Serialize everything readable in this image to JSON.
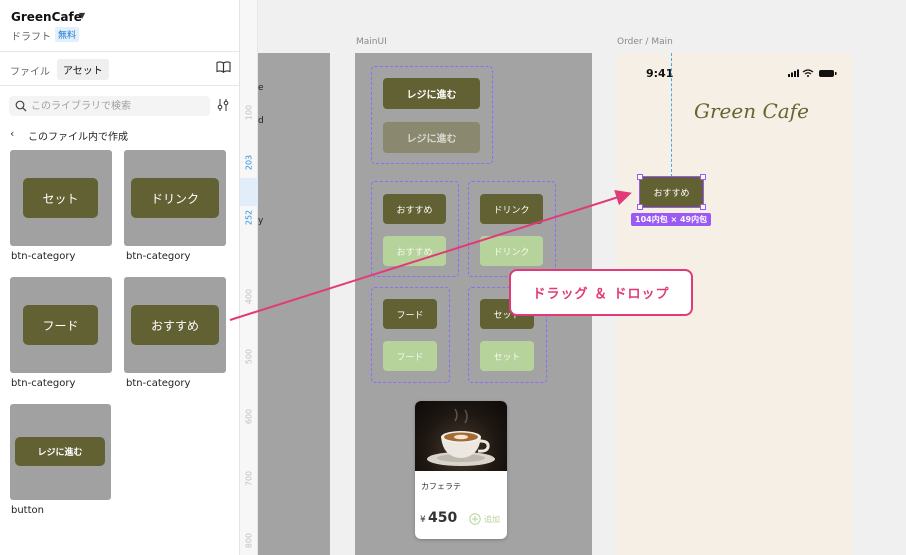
{
  "project": {
    "name": "GreenCafe",
    "status": "ドラフト",
    "plan_badge": "無料"
  },
  "tabs": {
    "file": "ファイル",
    "assets": "アセット"
  },
  "search": {
    "placeholder": "このライブラリで検索"
  },
  "section": {
    "title": "このファイル内で作成"
  },
  "assets": [
    {
      "button_text": "セット",
      "label": "btn-category"
    },
    {
      "button_text": "ドリンク",
      "label": "btn-category"
    },
    {
      "button_text": "フード",
      "label": "btn-category"
    },
    {
      "button_text": "おすすめ",
      "label": "btn-category"
    },
    {
      "button_text": "レジに進む",
      "label": "button"
    }
  ],
  "ruler": {
    "ticks": [
      "100",
      "203",
      "252",
      "400",
      "500",
      "600",
      "700",
      "800"
    ]
  },
  "left_frame": {
    "fragments": [
      "e",
      "d",
      "y"
    ]
  },
  "frames": {
    "main_ui": {
      "label": "MainUI",
      "checkout_primary": "レジに進む",
      "checkout_disabled": "レジに進む",
      "categories": [
        {
          "default": "おすすめ",
          "inactive": "おすすめ"
        },
        {
          "default": "ドリンク",
          "inactive": "ドリンク"
        },
        {
          "default": "フード",
          "inactive": "フード"
        },
        {
          "default": "セット",
          "inactive": "セット"
        }
      ],
      "product_card": {
        "name": "カフェラテ",
        "currency": "¥",
        "price": "450",
        "add_label": "追加"
      }
    },
    "order_main": {
      "label": "Order / Main",
      "time": "9:41",
      "logo": "Green Cafe",
      "dropped_button": "おすすめ",
      "dimension_badge": "104内包 × 49内包"
    }
  },
  "annotation": {
    "callout": "ドラッグ ＆ ドロップ"
  },
  "colors": {
    "brand_olive": "#626133",
    "disabled_olive": "#8a8970",
    "light_green": "#b6d39b",
    "selection_purple": "#9b59f6",
    "annotation_pink": "#e23a78",
    "order_bg": "#f5efe5"
  }
}
